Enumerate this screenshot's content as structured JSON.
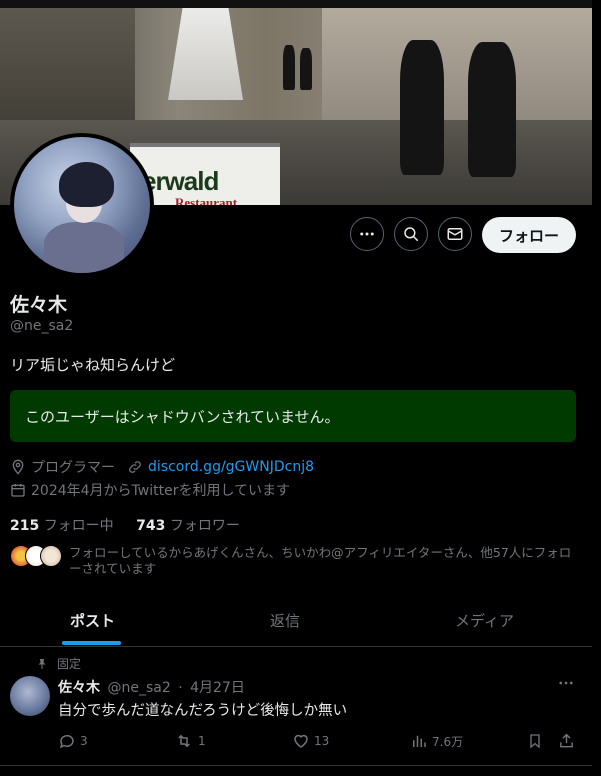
{
  "banner": {
    "sign_text": "erwald",
    "sign_subtext": "Restaurant"
  },
  "profile": {
    "name": "佐々木",
    "handle": "@ne_sa2",
    "bio": "リア垢じゃね知らんけど",
    "shadowban_status": "このユーザーはシャドウバンされていません。",
    "location": "プログラマー",
    "link": "discord.gg/gGWNJDcnj8",
    "joined": "2024年4月からTwitterを利用しています",
    "following_count": "215",
    "following_label": "フォロー中",
    "followers_count": "743",
    "followers_label": "フォロワー",
    "known_followers": "フォローしているからあげくんさん、ちいかわ@アフィリエイターさん、他57人にフォローされています"
  },
  "actions": {
    "more_icon": "more-icon",
    "search_icon": "search-icon",
    "message_icon": "mail-icon",
    "follow_label": "フォロー"
  },
  "tabs": [
    {
      "label": "ポスト",
      "active": true
    },
    {
      "label": "返信",
      "active": false
    },
    {
      "label": "メディア",
      "active": false
    }
  ],
  "post": {
    "pinned_label": "固定",
    "author_name": "佐々木",
    "author_handle": "@ne_sa2",
    "separator": "·",
    "date": "4月27日",
    "text": "自分で歩んだ道なんだろうけど後悔しか無い",
    "replies": "3",
    "reposts": "1",
    "likes": "13",
    "views": "7.6万"
  },
  "colors": {
    "accent": "#1d9bf0",
    "shadowban_box": "#003a00",
    "background": "#000000"
  }
}
